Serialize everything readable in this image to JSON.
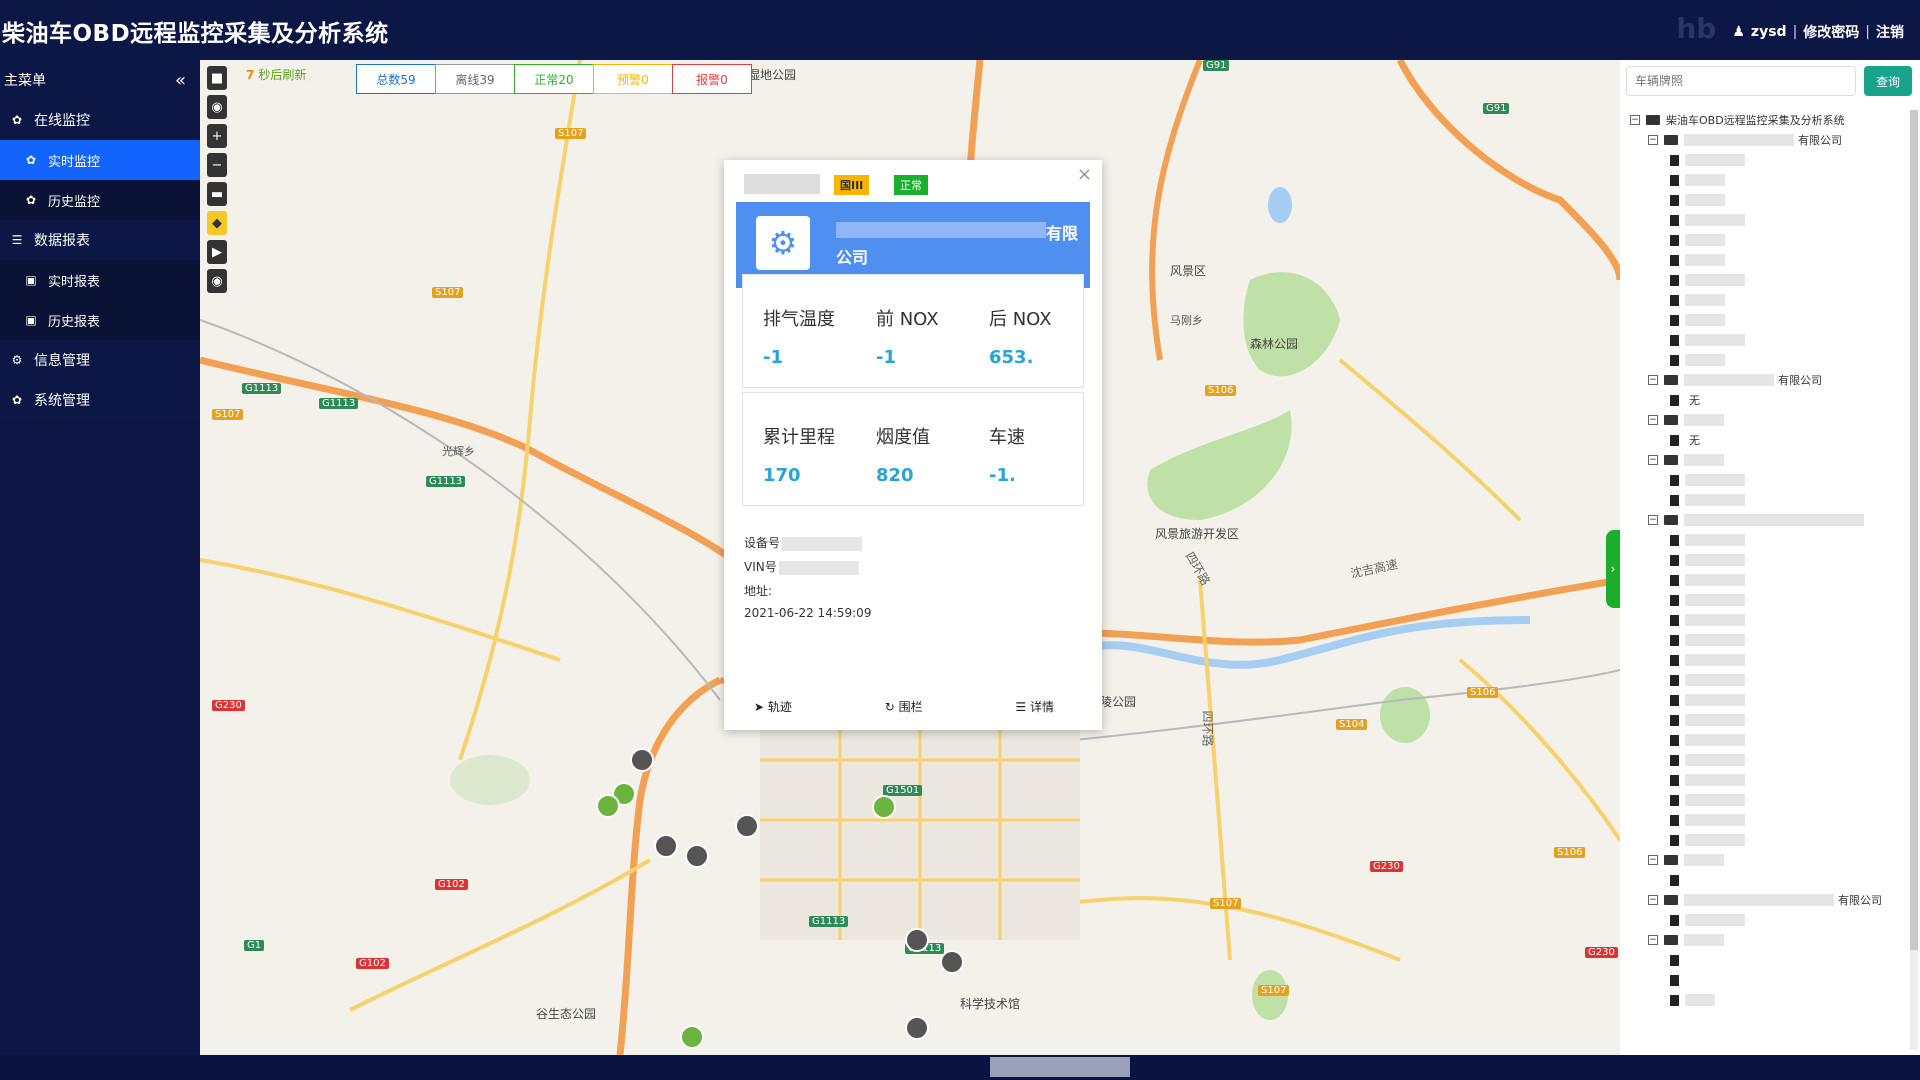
{
  "header": {
    "title": "柴油车OBD远程监控采集及分析系统",
    "logo_text": "hb",
    "user": "zysd",
    "change_password": "修改密码",
    "logout": "注销",
    "sep": "|"
  },
  "sidebar": {
    "menu_title": "主菜单",
    "collapse_icon": "«",
    "items": [
      {
        "label": "在线监控",
        "type": "group",
        "icon": "pin-icon"
      },
      {
        "label": "实时监控",
        "type": "sub",
        "active": true,
        "icon": "pin-icon"
      },
      {
        "label": "历史监控",
        "type": "sub",
        "icon": "pin-icon"
      },
      {
        "label": "数据报表",
        "type": "group",
        "icon": "database-icon"
      },
      {
        "label": "实时报表",
        "type": "sub",
        "icon": "file-icon"
      },
      {
        "label": "历史报表",
        "type": "sub",
        "icon": "file-icon"
      },
      {
        "label": "信息管理",
        "type": "group",
        "icon": "gears-icon"
      },
      {
        "label": "系统管理",
        "type": "group",
        "icon": "pin-icon"
      }
    ]
  },
  "map": {
    "refresh_num": "7",
    "refresh_text": "秒后刷新",
    "stats": {
      "total": "总数59",
      "offline": "离线39",
      "normal": "正常20",
      "warn": "预警0",
      "alarm": "报警0"
    },
    "labels": {
      "wetland": "湿地公园",
      "scenic": "风景区",
      "forest": "森林公园",
      "tourism": "风景旅游开发区",
      "valley": "谷生态公园",
      "science": "科学技术馆",
      "mashou": "马刚乡",
      "guanghui": "光辉乡",
      "ring": "四环路",
      "ring2": "四环路",
      "highway": "沈吉高速",
      "ling": "陵公园"
    },
    "road_shields": [
      "S107",
      "S107",
      "S107",
      "G1",
      "G1113",
      "G1113",
      "G1113",
      "G230",
      "G1501",
      "S106",
      "S106",
      "S104",
      "S106",
      "G230",
      "G230",
      "S107",
      "G102",
      "G102",
      "G1113",
      "G1113",
      "G1",
      "S107",
      "G91",
      "G91"
    ]
  },
  "popup": {
    "close": "×",
    "badge_std": "国III",
    "badge_status": "正常",
    "company_tail": "有限",
    "company_tail2": "公司",
    "metrics_row1": [
      {
        "label": "排气温度",
        "value": "-1"
      },
      {
        "label": "前 NOX",
        "value": "-1"
      },
      {
        "label": "后 NOX",
        "value": "653."
      }
    ],
    "metrics_row2": [
      {
        "label": "累计里程",
        "value": "170"
      },
      {
        "label": "烟度值",
        "value": "820"
      },
      {
        "label": "车速",
        "value": "-1."
      }
    ],
    "device_label": "设备号",
    "vin_label": "VIN号",
    "address_label": "地址:",
    "time": "2021-06-22 14:59:09",
    "actions": {
      "track": "轨迹",
      "fence": "围栏",
      "detail": "详情"
    }
  },
  "right_panel": {
    "search_placeholder": "车辆牌照",
    "search_button": "查询",
    "tree_root": "柴油车OBD远程监控采集及分析系统",
    "company_suffix": "有限公司",
    "none_label": "无"
  }
}
